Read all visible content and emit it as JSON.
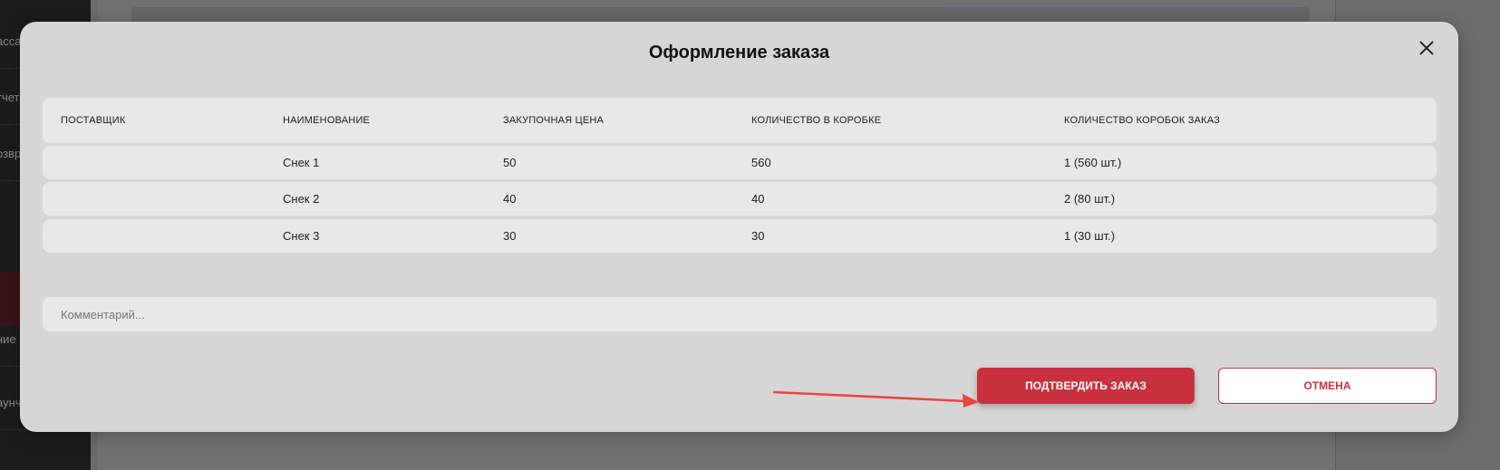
{
  "background": {
    "sidebar_items": [
      "асса",
      "тчет",
      "озвр",
      "ние",
      "аунч"
    ]
  },
  "modal": {
    "title": "Оформление заказа",
    "close_icon": "close-icon"
  },
  "table": {
    "headers": [
      "ПОСТАВЩИК",
      "НАИМЕНОВАНИЕ",
      "ЗАКУПОЧНАЯ ЦЕНА",
      "КОЛИЧЕСТВО В КОРОБКЕ",
      "КОЛИЧЕСТВО КОРОБОК ЗАКАЗ"
    ],
    "rows": [
      [
        "",
        "Снек 1",
        "50",
        "560",
        "1 (560 шт.)"
      ],
      [
        "",
        "Снек 2",
        "40",
        "40",
        "2 (80 шт.)"
      ],
      [
        "",
        "Снек 3",
        "30",
        "30",
        "1 (30 шт.)"
      ]
    ]
  },
  "comment": {
    "placeholder": "Комментарий...",
    "value": ""
  },
  "actions": {
    "confirm_label": "ПОДТВЕРДИТЬ ЗАКАЗ",
    "cancel_label": "ОТМЕНА"
  },
  "colors": {
    "accent": "#c8313d",
    "annotation_arrow": "#e8453c"
  }
}
